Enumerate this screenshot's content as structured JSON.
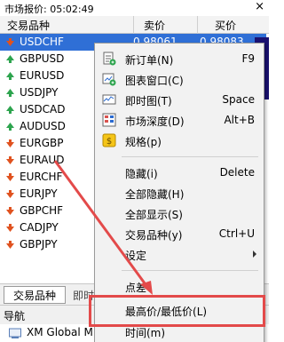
{
  "title": "市场报价: 05:02:49",
  "header": {
    "symbol": "交易品种",
    "bid": "卖价",
    "ask": "买价"
  },
  "rows": [
    {
      "symbol": "USDCHF",
      "dir": "down",
      "bid": "0.98061",
      "ask": "0.98083",
      "selected": true
    },
    {
      "symbol": "GBPUSD",
      "dir": "up"
    },
    {
      "symbol": "EURUSD",
      "dir": "up"
    },
    {
      "symbol": "USDJPY",
      "dir": "up"
    },
    {
      "symbol": "USDCAD",
      "dir": "up"
    },
    {
      "symbol": "AUDUSD",
      "dir": "up"
    },
    {
      "symbol": "EURGBP",
      "dir": "down"
    },
    {
      "symbol": "EURAUD",
      "dir": "down"
    },
    {
      "symbol": "EURCHF",
      "dir": "down"
    },
    {
      "symbol": "EURJPY",
      "dir": "down"
    },
    {
      "symbol": "GBPCHF",
      "dir": "down"
    },
    {
      "symbol": "CADJPY",
      "dir": "down"
    },
    {
      "symbol": "GBPJPY",
      "dir": "down"
    }
  ],
  "tabs": {
    "tab1": "交易品种",
    "tab2": "即时"
  },
  "navigator": {
    "title": "导航",
    "item": "XM Global M"
  },
  "menu": {
    "items": [
      {
        "label": "新订单(N)",
        "shortcut": "F9",
        "icon": "new-order-icon"
      },
      {
        "label": "图表窗口(C)",
        "shortcut": "",
        "icon": "chart-window-icon"
      },
      {
        "label": "即时图(T)",
        "shortcut": "Space",
        "icon": "tick-chart-icon"
      },
      {
        "label": "市场深度(D)",
        "shortcut": "Alt+B",
        "icon": "market-depth-icon"
      },
      {
        "label": "规格(p)",
        "shortcut": "",
        "icon": "specification-icon"
      },
      {
        "label": "隐藏(i)",
        "shortcut": "Delete",
        "icon": ""
      },
      {
        "label": "全部隐藏(H)",
        "shortcut": "",
        "icon": ""
      },
      {
        "label": "全部显示(S)",
        "shortcut": "",
        "icon": ""
      },
      {
        "label": "交易品种(y)",
        "shortcut": "Ctrl+U",
        "icon": ""
      },
      {
        "label": "设定",
        "shortcut": "",
        "icon": ""
      },
      {
        "label": "点差",
        "shortcut": "",
        "icon": ""
      },
      {
        "label": "最高价/最低价(L)",
        "shortcut": "",
        "icon": ""
      },
      {
        "label": "时间(m)",
        "shortcut": "",
        "icon": ""
      }
    ]
  },
  "colors": {
    "selected": "#2f6fd6",
    "up": "#2da44e",
    "down": "#e0521f",
    "highlight": "#e34a4a"
  }
}
